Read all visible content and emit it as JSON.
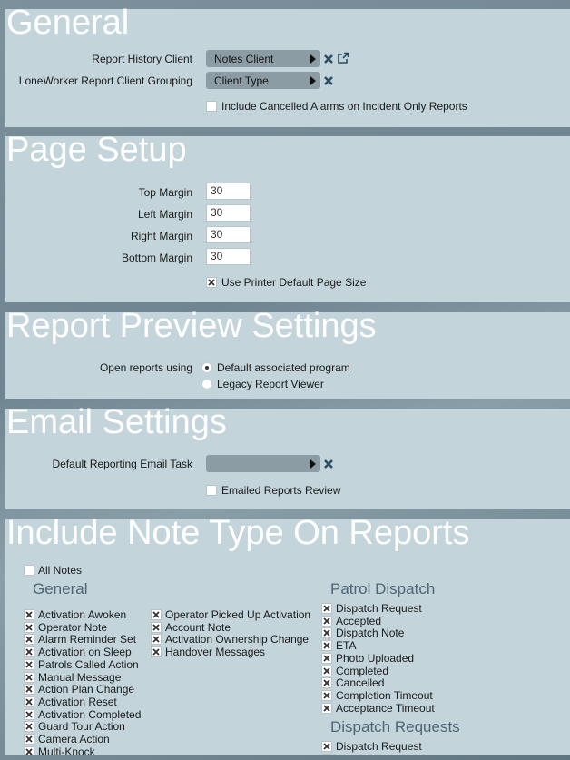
{
  "colors": {
    "panel_bg": "#c3d4db",
    "title_color": "#ffffff",
    "selector_bg": "#8c9ca5",
    "icon_blue": "#2c4d62",
    "group_heading": "#4e6674"
  },
  "general": {
    "title": "General",
    "report_history_client": {
      "label": "Report History Client",
      "value": "Notes Client",
      "icons": [
        "clear-x-icon",
        "external-link-icon"
      ]
    },
    "loneworker_grouping": {
      "label": "LoneWorker Report Client Grouping",
      "value": "Client Type",
      "icons": [
        "clear-x-icon"
      ]
    },
    "include_cancelled": {
      "label": "Include Cancelled Alarms on Incident Only Reports",
      "checked": false
    }
  },
  "page_setup": {
    "title": "Page Setup",
    "fields": [
      {
        "label": "Top Margin",
        "value": "30"
      },
      {
        "label": "Left Margin",
        "value": "30"
      },
      {
        "label": "Right Margin",
        "value": "30"
      },
      {
        "label": "Bottom Margin",
        "value": "30"
      }
    ],
    "use_printer_default": {
      "label": "Use Printer Default Page Size",
      "checked": true
    }
  },
  "report_preview": {
    "title": "Report Preview Settings",
    "label": "Open reports using",
    "options": [
      {
        "label": "Default associated program",
        "selected": true
      },
      {
        "label": "Legacy Report Viewer",
        "selected": false
      }
    ]
  },
  "email": {
    "title": "Email Settings",
    "default_task": {
      "label": "Default Reporting Email Task",
      "value": ""
    },
    "emailed_review": {
      "label": "Emailed Reports Review",
      "checked": false
    }
  },
  "notes": {
    "title": "Include Note Type On Reports",
    "all_notes": {
      "label": "All Notes",
      "checked": false
    },
    "groups": {
      "general": {
        "heading": "General",
        "col1": [
          "Activation Awoken",
          "Operator Note",
          "Alarm Reminder Set",
          "Activation on Sleep",
          "Patrols Called Action",
          "Manual Message",
          "Action Plan Change",
          "Activation Reset",
          "Activation Completed",
          "Guard Tour Action",
          "Camera Action",
          "Multi-Knock"
        ],
        "col2": [
          "Operator Picked Up Activation",
          "Account Note",
          "Activation Ownership Change",
          "Handover Messages"
        ]
      },
      "patrol_dispatch": {
        "heading": "Patrol Dispatch",
        "items": [
          "Dispatch Request",
          "Accepted",
          "Dispatch Note",
          "ETA",
          "Photo Uploaded",
          "Completed",
          "Cancelled",
          "Completion Timeout",
          "Acceptance Timeout"
        ]
      },
      "dispatch_requests": {
        "heading": "Dispatch Requests",
        "items": [
          "Dispatch Request",
          "Dispatch Note"
        ]
      }
    }
  }
}
